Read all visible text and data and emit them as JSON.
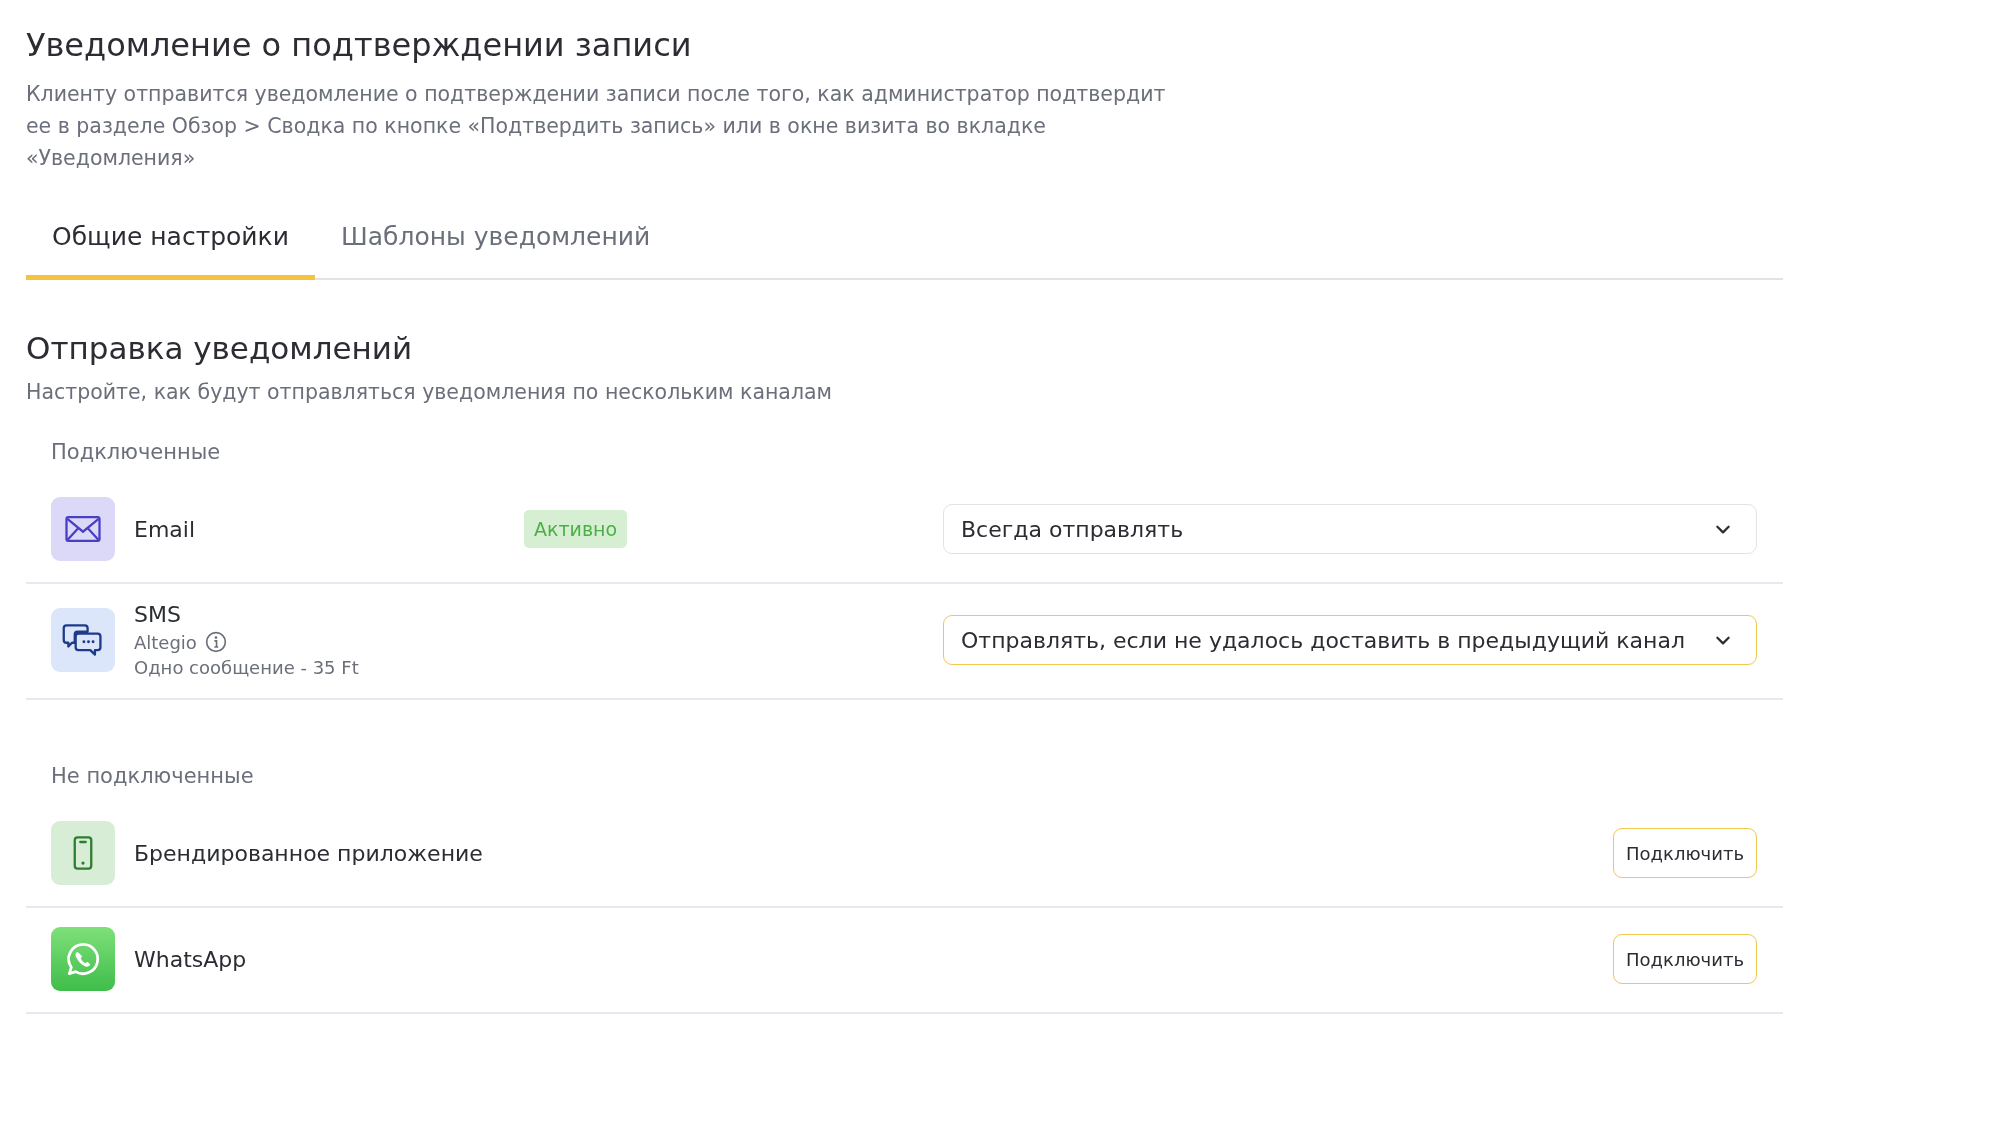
{
  "header": {
    "title": "Уведомление о подтверждении записи",
    "description": "Клиенту отправится уведомление о подтверждении записи после того, как администратор подтвердит ее в разделе Обзор > Сводка по кнопке «Подтвердить запись» или в окне визита во вкладке «Уведомления»"
  },
  "tabs": [
    {
      "label": "Общие настройки",
      "selected": true
    },
    {
      "label": "Шаблоны уведомлений",
      "selected": false
    }
  ],
  "section": {
    "title": "Отправка уведомлений",
    "subtitle": "Настройте, как будут отправляться уведомления по нескольким каналам"
  },
  "groups": [
    {
      "label": "Подключенные",
      "channels": [
        {
          "kind": "email",
          "name": "Email",
          "badge": "Активно",
          "dropdown": {
            "value": "Всегда отправлять",
            "highlighted": false
          }
        },
        {
          "kind": "sms",
          "name": "SMS",
          "provider": "Altegio",
          "note": "Одно сообщение - 35 Ft",
          "dropdown": {
            "value": "Отправлять, если не удалось доставить в предыдущий канал",
            "highlighted": true
          }
        }
      ]
    },
    {
      "label": "Не подключенные",
      "channels": [
        {
          "kind": "app",
          "name": "Брендированное приложение",
          "button": "Подключить"
        },
        {
          "kind": "whatsapp",
          "name": "WhatsApp",
          "button": "Подключить"
        }
      ]
    }
  ]
}
